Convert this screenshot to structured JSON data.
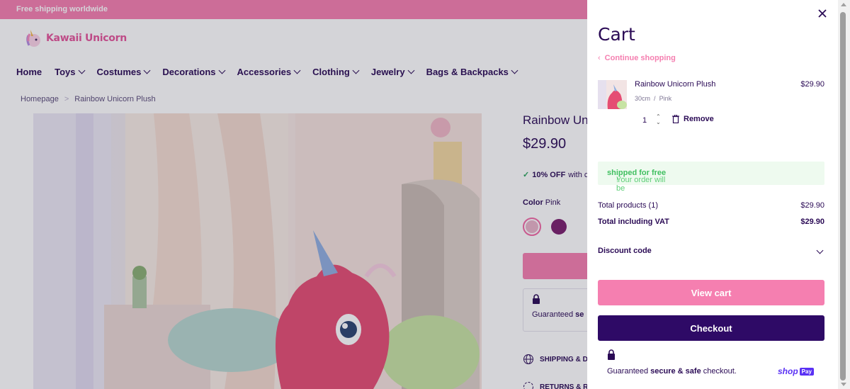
{
  "announcement": "Free shipping worldwide",
  "logo": {
    "text": "Kawaii Unicorn",
    "icon": "unicorn-logo-icon"
  },
  "nav": {
    "items": [
      {
        "label": "Home",
        "has_dropdown": false
      },
      {
        "label": "Toys",
        "has_dropdown": true
      },
      {
        "label": "Costumes",
        "has_dropdown": true
      },
      {
        "label": "Decorations",
        "has_dropdown": true
      },
      {
        "label": "Accessories",
        "has_dropdown": true
      },
      {
        "label": "Clothing",
        "has_dropdown": true
      },
      {
        "label": "Jewelry",
        "has_dropdown": true
      },
      {
        "label": "Bags & Backpacks",
        "has_dropdown": true
      }
    ]
  },
  "breadcrumb": {
    "home": "Homepage",
    "separator": ">",
    "current": "Rainbow Unicorn Plush"
  },
  "product": {
    "title": "Rainbow Uni",
    "price": "$29.90",
    "discount_bold": "10% OFF",
    "discount_rest": "with c",
    "color_label": "Color",
    "color_value": "Pink",
    "guarantee_text": "Guaranteed",
    "guarantee_bold": "se",
    "shipping_label": "SHIPPING & D",
    "returns_label": "RETURNS & R"
  },
  "cart": {
    "title": "Cart",
    "continue_label": "Continue shopping",
    "item": {
      "name": "Rainbow Unicorn Plush",
      "size": "30cm",
      "variant_sep": "/",
      "color": "Pink",
      "price": "$29.90",
      "quantity": "1",
      "remove_label": "Remove"
    },
    "shipping_msg_prefix": "Your order will be ",
    "shipping_msg_bold": "shipped for free",
    "shipping_msg_suffix": "!",
    "total_products_label": "Total products (1)",
    "total_products_value": "$29.90",
    "total_vat_label": "Total including VAT",
    "total_vat_value": "$29.90",
    "discount_label": "Discount code",
    "view_cart_label": "View cart",
    "checkout_label": "Checkout",
    "secure_prefix": "Guaranteed ",
    "secure_bold": "secure & safe",
    "secure_suffix": " checkout.",
    "shoppay_shop": "shop",
    "shoppay_pay": "Pay"
  },
  "colors": {
    "accent_pink": "#f57fb0",
    "dark_purple": "#2e0a66",
    "success_green": "#3fbf5f"
  }
}
